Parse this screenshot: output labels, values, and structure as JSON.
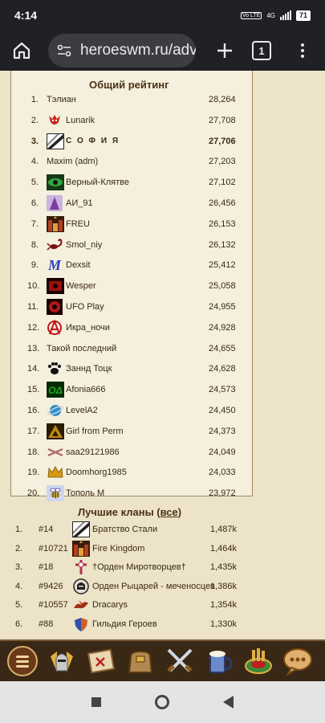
{
  "status": {
    "time": "4:14",
    "network": "4G",
    "battery": "71"
  },
  "browser": {
    "url": "heroeswm.ru/adv",
    "tab_count": "1"
  },
  "rating": {
    "title": "Общий рейтинг",
    "rows": [
      {
        "pos": "1.",
        "name": "Тэлиан",
        "score": "28,264",
        "icon": "none",
        "color": ""
      },
      {
        "pos": "2.",
        "name": "Lunarik",
        "score": "27,708",
        "icon": "red-dragon",
        "color": "#c8261e"
      },
      {
        "pos": "3.",
        "name": "С О Ф И Я",
        "score": "27,706",
        "icon": "steel-brotherhood",
        "color": "#222222"
      },
      {
        "pos": "4.",
        "name": "Maxim (adm)",
        "score": "27,203",
        "icon": "none",
        "color": ""
      },
      {
        "pos": "5.",
        "name": "Верный-Клятве",
        "score": "27,102",
        "icon": "green-eye",
        "color": "#2fa83a"
      },
      {
        "pos": "6.",
        "name": "АИ_91",
        "score": "26,456",
        "icon": "purple-emblem",
        "color": "#7a3fa0"
      },
      {
        "pos": "7.",
        "name": "FREU",
        "score": "26,153",
        "icon": "kingdom-castle",
        "color": "#b5401e"
      },
      {
        "pos": "8.",
        "name": "Smol_niy",
        "score": "26,132",
        "icon": "scorpion",
        "color": "#7a1010"
      },
      {
        "pos": "9.",
        "name": "Dexsit",
        "score": "25,412",
        "icon": "blue-m",
        "color": "#2a3fc0"
      },
      {
        "pos": "10.",
        "name": "Wesper",
        "score": "25,058",
        "icon": "red-badge",
        "color": "#9c1010"
      },
      {
        "pos": "11.",
        "name": "UFO Play",
        "score": "24,955",
        "icon": "red-dark-badge",
        "color": "#b01818"
      },
      {
        "pos": "12.",
        "name": "Икра_ночи",
        "score": "24,928",
        "icon": "anarchy",
        "color": "#c01818"
      },
      {
        "pos": "13.",
        "name": "Такой последний",
        "score": "24,655",
        "icon": "none",
        "color": ""
      },
      {
        "pos": "14.",
        "name": "Заннд Тоцк",
        "score": "24,628",
        "icon": "paw",
        "color": "#111111"
      },
      {
        "pos": "15.",
        "name": "Afonia666",
        "score": "24,573",
        "icon": "green-od",
        "color": "#1faa1f"
      },
      {
        "pos": "16.",
        "name": "LevelA2",
        "score": "24,450",
        "icon": "planet",
        "color": "#2f8fd0"
      },
      {
        "pos": "17.",
        "name": "Girl from Perm",
        "score": "24,373",
        "icon": "gold-triangle",
        "color": "#c08a10"
      },
      {
        "pos": "18.",
        "name": "saa29121986",
        "score": "24,049",
        "icon": "crossed-swords",
        "color": "#b07070"
      },
      {
        "pos": "19.",
        "name": "Doomhorg1985",
        "score": "24,033",
        "icon": "crown",
        "color": "#d99a10"
      },
      {
        "pos": "20.",
        "name": "Тополь М",
        "score": "23,972",
        "icon": "bee",
        "color": "#3a3a90"
      }
    ]
  },
  "clans": {
    "title_prefix": "Лучшие кланы (",
    "link": "все",
    "title_suffix": ")",
    "rows": [
      {
        "pos": "1.",
        "id": "#14",
        "name": "Братство Стали",
        "score": "1,487k",
        "icon": "steel-brotherhood",
        "color": "#222222"
      },
      {
        "pos": "2.",
        "id": "#10721",
        "name": "Fire Kingdom",
        "score": "1,464k",
        "icon": "kingdom-castle",
        "color": "#b5401e"
      },
      {
        "pos": "3.",
        "id": "#18",
        "name": "†Орден Миротворцев†",
        "score": "1,435k",
        "icon": "cross-emblem",
        "color": "#b03050"
      },
      {
        "pos": "4.",
        "id": "#9426",
        "name": "Орден Рыцарей - меченосцев",
        "score": "1,386k",
        "icon": "knight-helm",
        "color": "#222222"
      },
      {
        "pos": "5.",
        "id": "#10557",
        "name": "Dracarys",
        "score": "1,354k",
        "icon": "dragon",
        "color": "#a0301a"
      },
      {
        "pos": "6.",
        "id": "#88",
        "name": "Гильдия Героев",
        "score": "1,330k",
        "icon": "hero-shield",
        "color": "#d06020"
      }
    ]
  },
  "game_nav": [
    "menu-icon",
    "knight-helmet-icon",
    "map-scroll-icon",
    "bag-icon",
    "crossed-swords-icon",
    "tavern-mug-icon",
    "roulette-icon",
    "chat-icon"
  ]
}
